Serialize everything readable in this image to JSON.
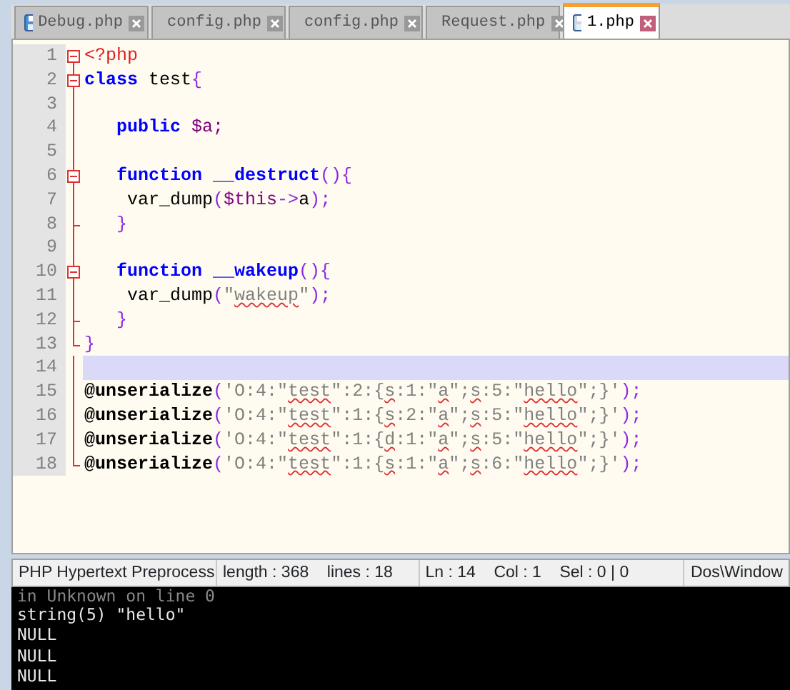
{
  "tabs": [
    {
      "label": "Debug.php",
      "selected": false
    },
    {
      "label": "config.php",
      "selected": false
    },
    {
      "label": "config.php",
      "selected": false
    },
    {
      "label": "Request.php",
      "selected": false
    },
    {
      "label": "1.php",
      "selected": true
    }
  ],
  "editor": {
    "lines": [
      {
        "number": "1",
        "kind": "fold_start",
        "current": false,
        "tokens": [
          {
            "text": "<?php",
            "kind": "tag"
          }
        ]
      },
      {
        "number": "2",
        "kind": "fold_start",
        "current": false,
        "tokens": [
          {
            "text": "class",
            "kind": "keyword"
          },
          {
            "text": " test",
            "kind": "plain"
          },
          {
            "text": "{",
            "kind": "punct"
          }
        ]
      },
      {
        "number": "3",
        "kind": "fold_body",
        "current": false
      },
      {
        "number": "4",
        "kind": "fold_body",
        "current": false,
        "tokens": [
          {
            "text": "   public",
            "kind": "keyword"
          },
          {
            "text": " $a;",
            "kind": "var"
          }
        ]
      },
      {
        "number": "5",
        "kind": "fold_body",
        "current": false
      },
      {
        "number": "6",
        "kind": "fold_start",
        "current": false,
        "tokens": [
          {
            "text": "   function __destruct",
            "kind": "keyword"
          },
          {
            "text": "(){",
            "kind": "punct"
          }
        ]
      },
      {
        "number": "7",
        "kind": "fold_body",
        "current": false,
        "tokens": [
          {
            "text": "    var_dump",
            "kind": "plain"
          },
          {
            "text": "(",
            "kind": "punct"
          },
          {
            "text": "$this",
            "kind": "var"
          },
          {
            "text": "->",
            "kind": "punct"
          },
          {
            "text": "a",
            "kind": "plain"
          },
          {
            "text": ");",
            "kind": "punct"
          }
        ]
      },
      {
        "number": "8",
        "kind": "fold_end",
        "current": false,
        "tokens": [
          {
            "text": "   }",
            "kind": "punct"
          }
        ]
      },
      {
        "number": "9",
        "kind": "fold_body",
        "current": false
      },
      {
        "number": "10",
        "kind": "fold_start",
        "current": false,
        "tokens": [
          {
            "text": "   function __wakeup",
            "kind": "keyword"
          },
          {
            "text": "(){",
            "kind": "punct"
          }
        ]
      },
      {
        "number": "11",
        "kind": "fold_body",
        "current": false,
        "tokens": [
          {
            "text": "    var_dump",
            "kind": "plain"
          },
          {
            "text": "(",
            "kind": "punct"
          },
          {
            "text": "\"",
            "kind": "string"
          },
          {
            "text": "wakeup",
            "kind": "spell"
          },
          {
            "text": "\"",
            "kind": "string"
          },
          {
            "text": ");",
            "kind": "punct"
          }
        ]
      },
      {
        "number": "12",
        "kind": "fold_end",
        "current": false,
        "tokens": [
          {
            "text": "   }",
            "kind": "punct"
          }
        ]
      },
      {
        "number": "13",
        "kind": "fold_last",
        "current": false,
        "tokens": [
          {
            "text": "}",
            "kind": "punct"
          }
        ]
      },
      {
        "number": "14",
        "kind": "fold_body",
        "current": true
      },
      {
        "number": "15",
        "kind": "fold_body",
        "current": false,
        "tokens": [
          {
            "text": "@unserialize",
            "kind": "call"
          },
          {
            "text": "(",
            "kind": "punct"
          },
          {
            "text": "'O:4:\"",
            "kind": "string"
          },
          {
            "text": "test",
            "kind": "spell"
          },
          {
            "text": "\":2:{",
            "kind": "string"
          },
          {
            "text": "s",
            "kind": "spell"
          },
          {
            "text": ":1:\"",
            "kind": "string"
          },
          {
            "text": "a",
            "kind": "spell"
          },
          {
            "text": "\";",
            "kind": "string"
          },
          {
            "text": "s",
            "kind": "spell"
          },
          {
            "text": ":5:\"",
            "kind": "string"
          },
          {
            "text": "hello",
            "kind": "spell"
          },
          {
            "text": "\";}'",
            "kind": "string"
          },
          {
            "text": ");",
            "kind": "punct"
          }
        ]
      },
      {
        "number": "16",
        "kind": "fold_body",
        "current": false,
        "tokens": [
          {
            "text": "@unserialize",
            "kind": "call"
          },
          {
            "text": "(",
            "kind": "punct"
          },
          {
            "text": "'O:4:\"",
            "kind": "string"
          },
          {
            "text": "test",
            "kind": "spell"
          },
          {
            "text": "\":1:{",
            "kind": "string"
          },
          {
            "text": "s",
            "kind": "spell"
          },
          {
            "text": ":2:\"",
            "kind": "string"
          },
          {
            "text": "a",
            "kind": "spell"
          },
          {
            "text": "\";",
            "kind": "string"
          },
          {
            "text": "s",
            "kind": "spell"
          },
          {
            "text": ":5:\"",
            "kind": "string"
          },
          {
            "text": "hello",
            "kind": "spell"
          },
          {
            "text": "\";}'",
            "kind": "string"
          },
          {
            "text": ");",
            "kind": "punct"
          }
        ]
      },
      {
        "number": "17",
        "kind": "fold_body",
        "current": false,
        "tokens": [
          {
            "text": "@unserialize",
            "kind": "call"
          },
          {
            "text": "(",
            "kind": "punct"
          },
          {
            "text": "'O:4:\"",
            "kind": "string"
          },
          {
            "text": "test",
            "kind": "spell"
          },
          {
            "text": "\":1:{",
            "kind": "string"
          },
          {
            "text": "d",
            "kind": "spell"
          },
          {
            "text": ":1:\"",
            "kind": "string"
          },
          {
            "text": "a",
            "kind": "spell"
          },
          {
            "text": "\";",
            "kind": "string"
          },
          {
            "text": "s",
            "kind": "spell"
          },
          {
            "text": ":5:\"",
            "kind": "string"
          },
          {
            "text": "hello",
            "kind": "spell"
          },
          {
            "text": "\";}'",
            "kind": "string"
          },
          {
            "text": ");",
            "kind": "punct"
          }
        ]
      },
      {
        "number": "18",
        "kind": "fold_last",
        "current": false,
        "tokens": [
          {
            "text": "@unserialize",
            "kind": "call"
          },
          {
            "text": "(",
            "kind": "punct"
          },
          {
            "text": "'O:4:\"",
            "kind": "string"
          },
          {
            "text": "test",
            "kind": "spell"
          },
          {
            "text": "\":1:{",
            "kind": "string"
          },
          {
            "text": "s",
            "kind": "spell"
          },
          {
            "text": ":1:\"",
            "kind": "string"
          },
          {
            "text": "a",
            "kind": "spell"
          },
          {
            "text": "\";",
            "kind": "string"
          },
          {
            "text": "s",
            "kind": "spell"
          },
          {
            "text": ":6:\"",
            "kind": "string"
          },
          {
            "text": "hello",
            "kind": "spell"
          },
          {
            "text": "\";}'",
            "kind": "string"
          },
          {
            "text": ");",
            "kind": "punct"
          }
        ]
      }
    ]
  },
  "status_bar": [
    "PHP Hypertext Preprocess",
    "length : 368    lines : 18",
    "Ln : 14    Col : 1    Sel : 0 | 0",
    "Dos\\Window"
  ],
  "console": [
    "in Unknown on line 0",
    "string(5) \"hello\"",
    "NULL",
    "NULL",
    "NULL"
  ]
}
